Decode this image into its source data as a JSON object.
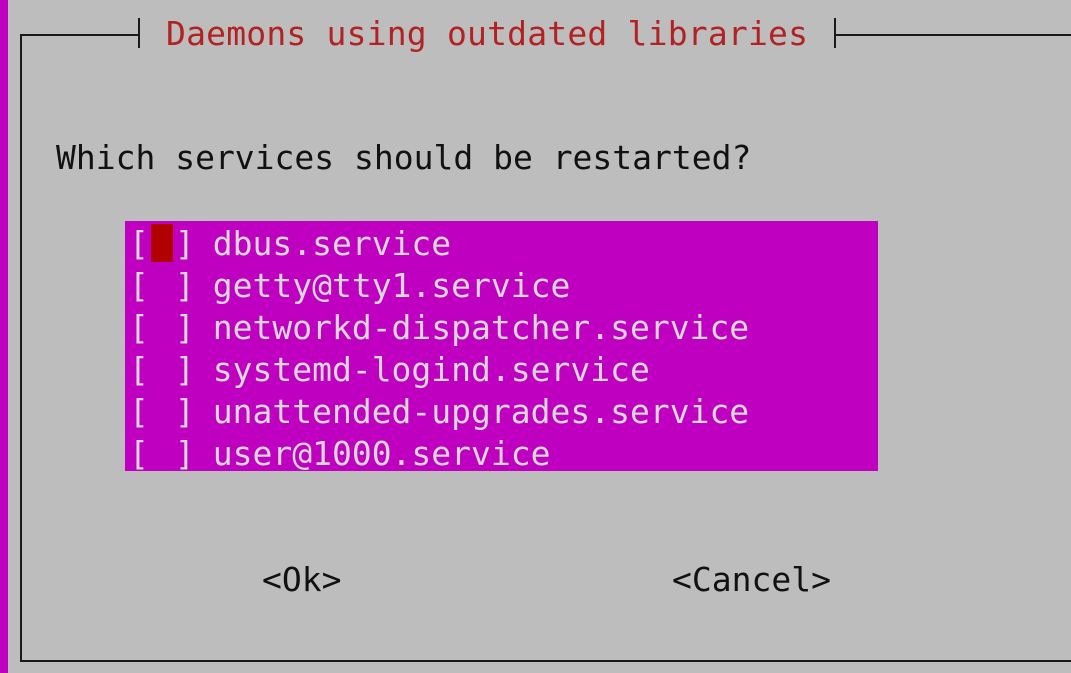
{
  "dialog": {
    "title": "Daemons using outdated libraries",
    "prompt": "Which services should be restarted?",
    "items": [
      {
        "label": "dbus.service",
        "checked": false,
        "focused": true
      },
      {
        "label": "getty@tty1.service",
        "checked": false,
        "focused": false
      },
      {
        "label": "networkd-dispatcher.service",
        "checked": false,
        "focused": false
      },
      {
        "label": "systemd-logind.service",
        "checked": false,
        "focused": false
      },
      {
        "label": "unattended-upgrades.service",
        "checked": false,
        "focused": false
      },
      {
        "label": "user@1000.service",
        "checked": false,
        "focused": false
      }
    ],
    "checkbox_open": "[",
    "checkbox_close": "]",
    "ok_label": "<Ok>",
    "cancel_label": "<Cancel>"
  },
  "colors": {
    "background": "#c000c0",
    "dialog": "#bdbdbd",
    "title": "#b22222",
    "cursor": "#b00000",
    "list_text": "#d8d8d8"
  }
}
